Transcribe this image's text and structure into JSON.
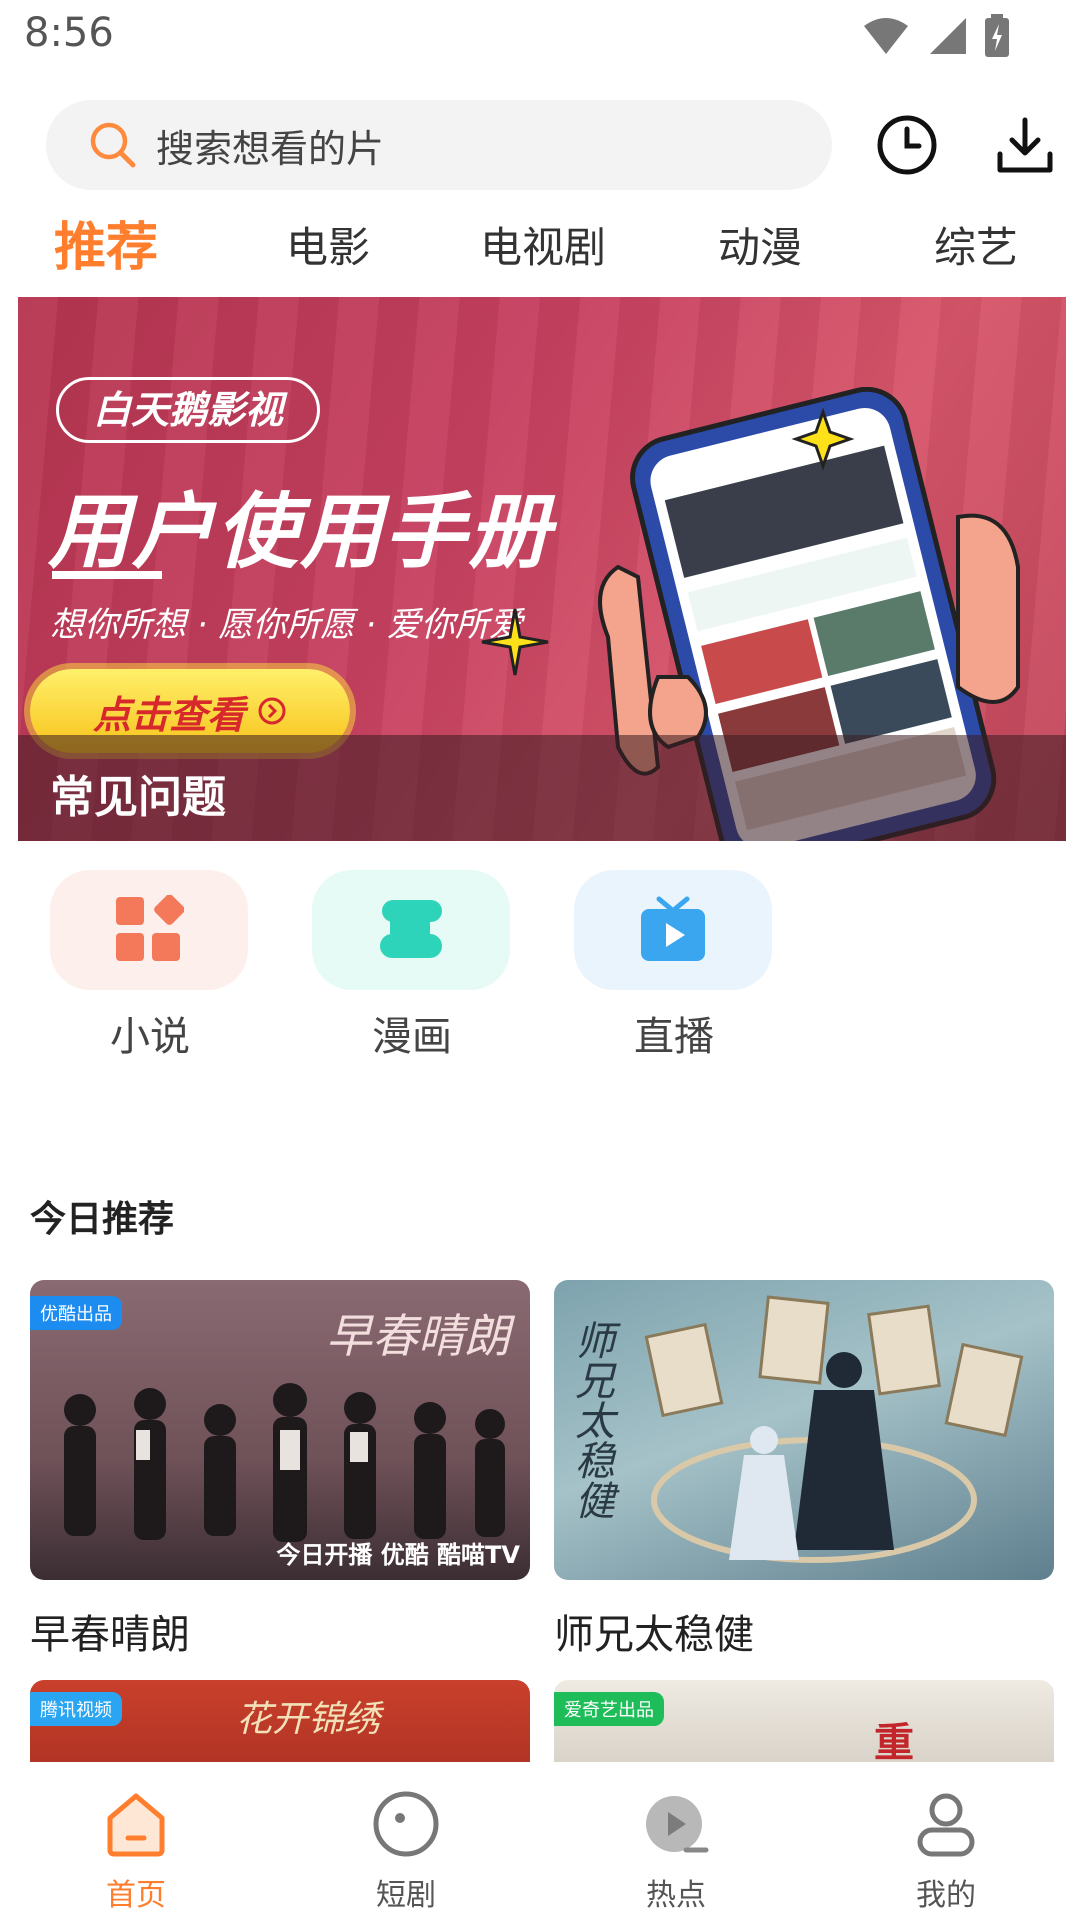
{
  "status": {
    "time": "8:56"
  },
  "search": {
    "placeholder": "搜索想看的片"
  },
  "tabs": [
    {
      "label": "推荐",
      "active": true
    },
    {
      "label": "电影"
    },
    {
      "label": "电视剧"
    },
    {
      "label": "动漫"
    },
    {
      "label": "综艺"
    }
  ],
  "banner": {
    "brand": "白天鹅影视",
    "title": "用户使用手册",
    "subtitle": "想你所想 · 愿你所愿 · 爱你所爱",
    "button": "点击查看",
    "caption": "常见问题"
  },
  "quick_links": [
    {
      "label": "小说",
      "icon": "grid-icon",
      "bg": "#fdf0ec",
      "color": "#f4795b"
    },
    {
      "label": "漫画",
      "icon": "comic-icon",
      "bg": "#e6faf6",
      "color": "#2ed4b9"
    },
    {
      "label": "直播",
      "icon": "tv-play-icon",
      "bg": "#eaf4fc",
      "color": "#3aa6ef"
    }
  ],
  "section": {
    "title": "今日推荐"
  },
  "cards": [
    {
      "title": "早春晴朗",
      "badge": "优酷出品",
      "poster_text": "早春晴朗",
      "footer": "今日开播  优酷  酷喵TV"
    },
    {
      "title": "师兄太稳健",
      "poster_text": "师兄太稳健"
    },
    {
      "title": "",
      "badge": "腾讯视频",
      "poster_text": "花开锦绣"
    },
    {
      "title": "",
      "badge": "爱奇艺出品",
      "poster_text": "重"
    }
  ],
  "bottom_nav": [
    {
      "label": "首页",
      "icon": "home-icon",
      "active": true
    },
    {
      "label": "短剧",
      "icon": "circle-icon"
    },
    {
      "label": "热点",
      "icon": "play-icon"
    },
    {
      "label": "我的",
      "icon": "user-icon"
    }
  ],
  "colors": {
    "accent": "#ff7e2e"
  }
}
